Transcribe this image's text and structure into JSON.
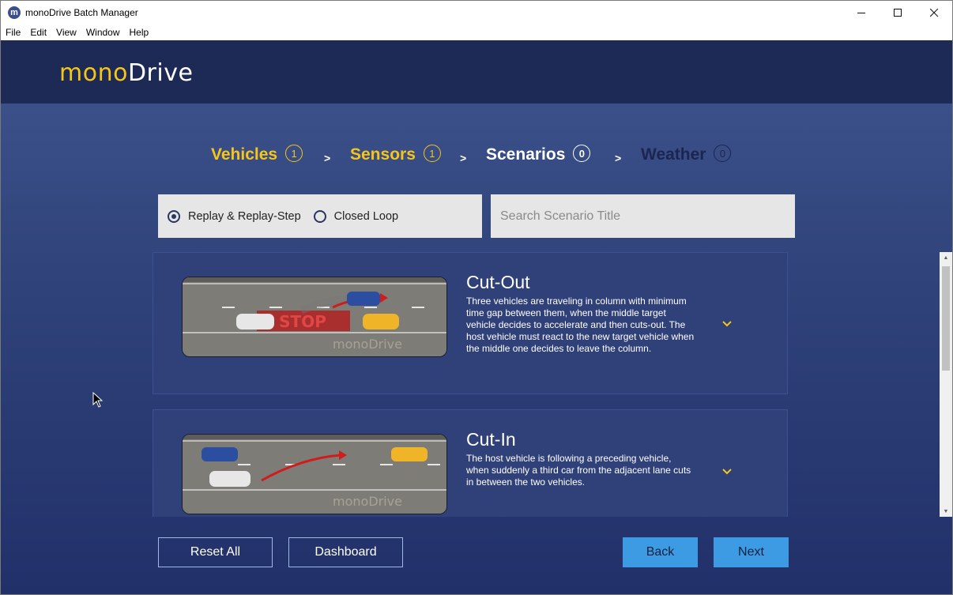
{
  "window": {
    "title": "monoDrive Batch Manager",
    "app_icon_letter": "m",
    "controls": {
      "minimize": "—",
      "maximize": "☐",
      "close": "✕"
    }
  },
  "menu": {
    "items": [
      "File",
      "Edit",
      "View",
      "Window",
      "Help"
    ]
  },
  "header": {
    "logo_part1": "mono",
    "logo_part2": "Drive",
    "logo_colors": {
      "mono": "#f5c518",
      "drive": "#ffffff"
    }
  },
  "steps": [
    {
      "label": "Vehicles",
      "count": "1",
      "state": "done"
    },
    {
      "label": "Sensors",
      "count": "1",
      "state": "done"
    },
    {
      "label": "Scenarios",
      "count": "0",
      "state": "current"
    },
    {
      "label": "Weather",
      "count": "0",
      "state": "future"
    }
  ],
  "step_separator": ">",
  "filter": {
    "options": [
      {
        "label": "Replay & Replay-Step",
        "checked": true
      },
      {
        "label": "Closed Loop",
        "checked": false
      }
    ],
    "search_placeholder": "Search Scenario Title"
  },
  "scenarios": [
    {
      "title": "Cut-Out",
      "description": "Three vehicles are traveling in column with minimum time gap between them, when the middle target vehicle decides to accelerate and then cuts-out. The host vehicle must react to the new target vehicle when the middle one decides to leave the column.",
      "thumb_stop_text": "STOP",
      "thumb_watermark": "monoDrive"
    },
    {
      "title": "Cut-In",
      "description": "The host vehicle is following a preceding vehicle, when suddenly a third car from the adjacent lane cuts in between the two vehicles.",
      "thumb_watermark": "monoDrive"
    }
  ],
  "buttons": {
    "reset_all": "Reset All",
    "dashboard": "Dashboard",
    "back": "Back",
    "next": "Next"
  },
  "colors": {
    "accent_yellow": "#f5c518",
    "header_bg": "#1e2a56",
    "primary_button": "#3c9be3"
  }
}
